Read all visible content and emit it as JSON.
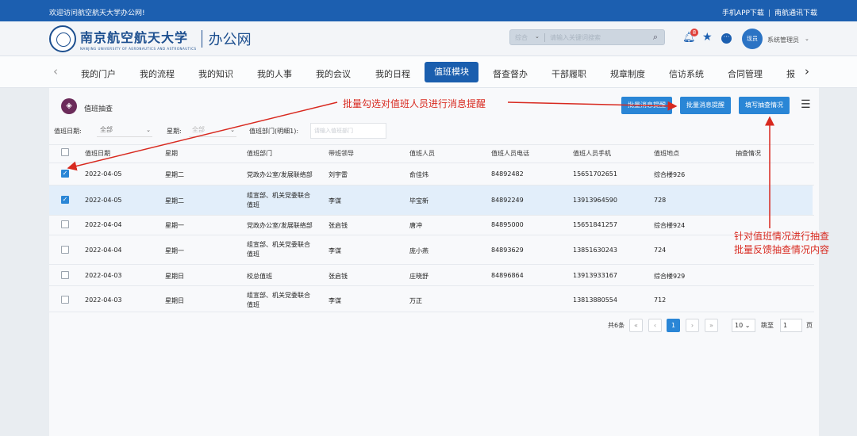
{
  "topbar": {
    "welcome": "欢迎访问航空航天大学办公网!",
    "app_download": "手机APP下载",
    "separator": "|",
    "contacts_download": "南航通讯下载"
  },
  "header": {
    "university_name": "南京航空航天大学",
    "university_name_en": "NANJING UNIVERSITY OF AERONAUTICS AND ASTRONAUTICS",
    "site_name": "办公网",
    "search_scope": "综合",
    "search_placeholder": "请输入关键词搜索",
    "notification_count": "8",
    "avatar_text": "现员",
    "user_name": "系统管理员"
  },
  "nav": {
    "items": [
      "我的门户",
      "我的流程",
      "我的知识",
      "我的人事",
      "我的会议",
      "我的日程",
      "值班模块",
      "督查督办",
      "干部履职",
      "规章制度",
      "信访系统",
      "合同管理",
      "报"
    ],
    "active_index": 6
  },
  "panel": {
    "title": "值班抽查",
    "buttons": [
      "批量消息提醒",
      "批量消息提醒",
      "填写抽查情况"
    ]
  },
  "filters": {
    "date_label": "值班日期:",
    "date_value": "全部",
    "weekday_label": "星期:",
    "weekday_value": "全部",
    "dept_label": "值班部门(明细1):",
    "dept_placeholder": "请输入值班部门"
  },
  "table": {
    "headers": [
      "值班日期",
      "星期",
      "值班部门",
      "带班领导",
      "值班人员",
      "值班人员电话",
      "值班人员手机",
      "值班地点",
      "抽查情况"
    ],
    "rows": [
      {
        "checked": true,
        "date": "2022-04-05",
        "weekday": "星期二",
        "dept": "党政办公室/发展联络部",
        "leader": "刘宇雷",
        "staff": "俞佳炜",
        "phone": "84892482",
        "mobile": "15651702651",
        "location": "综合楼926",
        "check": ""
      },
      {
        "checked": true,
        "date": "2022-04-05",
        "weekday": "星期二",
        "dept": "组宣部、机关党委联合值班",
        "leader": "李谋",
        "staff": "毕宝新",
        "phone": "84892249",
        "mobile": "13913964590",
        "location": "728",
        "check": ""
      },
      {
        "checked": false,
        "date": "2022-04-04",
        "weekday": "星期一",
        "dept": "党政办公室/发展联络部",
        "leader": "张启钱",
        "staff": "唐冲",
        "phone": "84895000",
        "mobile": "15651841257",
        "location": "综合楼924",
        "check": ""
      },
      {
        "checked": false,
        "date": "2022-04-04",
        "weekday": "星期一",
        "dept": "组宣部、机关党委联合值班",
        "leader": "李谋",
        "staff": "庞小燕",
        "phone": "84893629",
        "mobile": "13851630243",
        "location": "724",
        "check": ""
      },
      {
        "checked": false,
        "date": "2022-04-03",
        "weekday": "星期日",
        "dept": "校总值班",
        "leader": "张启钱",
        "staff": "庄晓舒",
        "phone": "84896864",
        "mobile": "13913933167",
        "location": "综合楼929",
        "check": ""
      },
      {
        "checked": false,
        "date": "2022-04-03",
        "weekday": "星期日",
        "dept": "组宣部、机关党委联合值班",
        "leader": "李谋",
        "staff": "万正",
        "phone": "",
        "mobile": "13813880554",
        "location": "712",
        "check": ""
      }
    ]
  },
  "pagination": {
    "total": "共6条",
    "prev": "«",
    "prev2": "‹",
    "current": "1",
    "next2": "›",
    "next": "»",
    "page_size": "10",
    "goto_label": "跳至",
    "goto_value": "1",
    "page_unit": "页"
  },
  "annotations": {
    "top": "批量勾选对值班人员进行消息提醒",
    "right_line1": "针对值班情况进行抽查",
    "right_line2": "批量反馈抽查情况内容"
  },
  "colors": {
    "topbar": "#1c5fb0",
    "primary_button": "#2a86d6",
    "annotation": "#d8291f"
  }
}
